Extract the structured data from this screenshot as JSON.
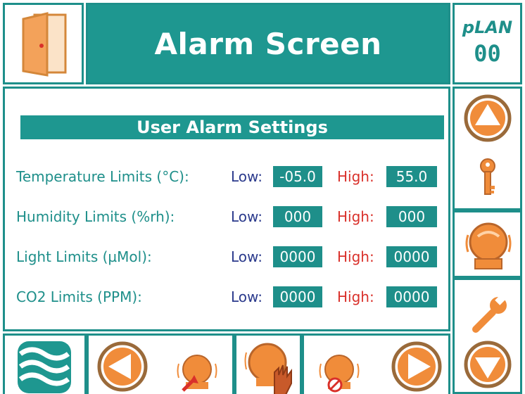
{
  "header": {
    "title": "Alarm Screen",
    "plan_label": "pLAN",
    "plan_number": "00"
  },
  "main": {
    "section_title": "User Alarm Settings",
    "rows": [
      {
        "label": "Temperature Limits (°C):",
        "low_label": "Low:",
        "low_value": "-05.0",
        "high_label": "High:",
        "high_value": "55.0"
      },
      {
        "label": "Humidity Limits (%rh):",
        "low_label": "Low:",
        "low_value": "000",
        "high_label": "High:",
        "high_value": "000"
      },
      {
        "label": "Light Limits (µMol):",
        "low_label": "Low:",
        "low_value": "0000",
        "high_label": "High:",
        "high_value": "0000"
      },
      {
        "label": "CO2 Limits (PPM):",
        "low_label": "Low:",
        "low_value": "0000",
        "high_label": "High:",
        "high_value": "0000"
      }
    ]
  },
  "icons": {
    "door": "door-icon",
    "up": "up-arrow-icon",
    "key": "key-icon",
    "alarm": "alarm-bell-icon",
    "wrench": "wrench-icon",
    "down": "down-arrow-icon",
    "logo": "waves-logo-icon",
    "left": "left-arrow-icon",
    "alarm_reset": "alarm-reset-icon",
    "alarm_silence": "alarm-silence-hand-icon",
    "alarm_mute": "alarm-mute-icon",
    "right": "right-arrow-icon"
  },
  "colors": {
    "teal": "#1e9790",
    "orange": "#f08c3a",
    "low_label": "#2b3a8c",
    "high_label": "#d9302a"
  }
}
